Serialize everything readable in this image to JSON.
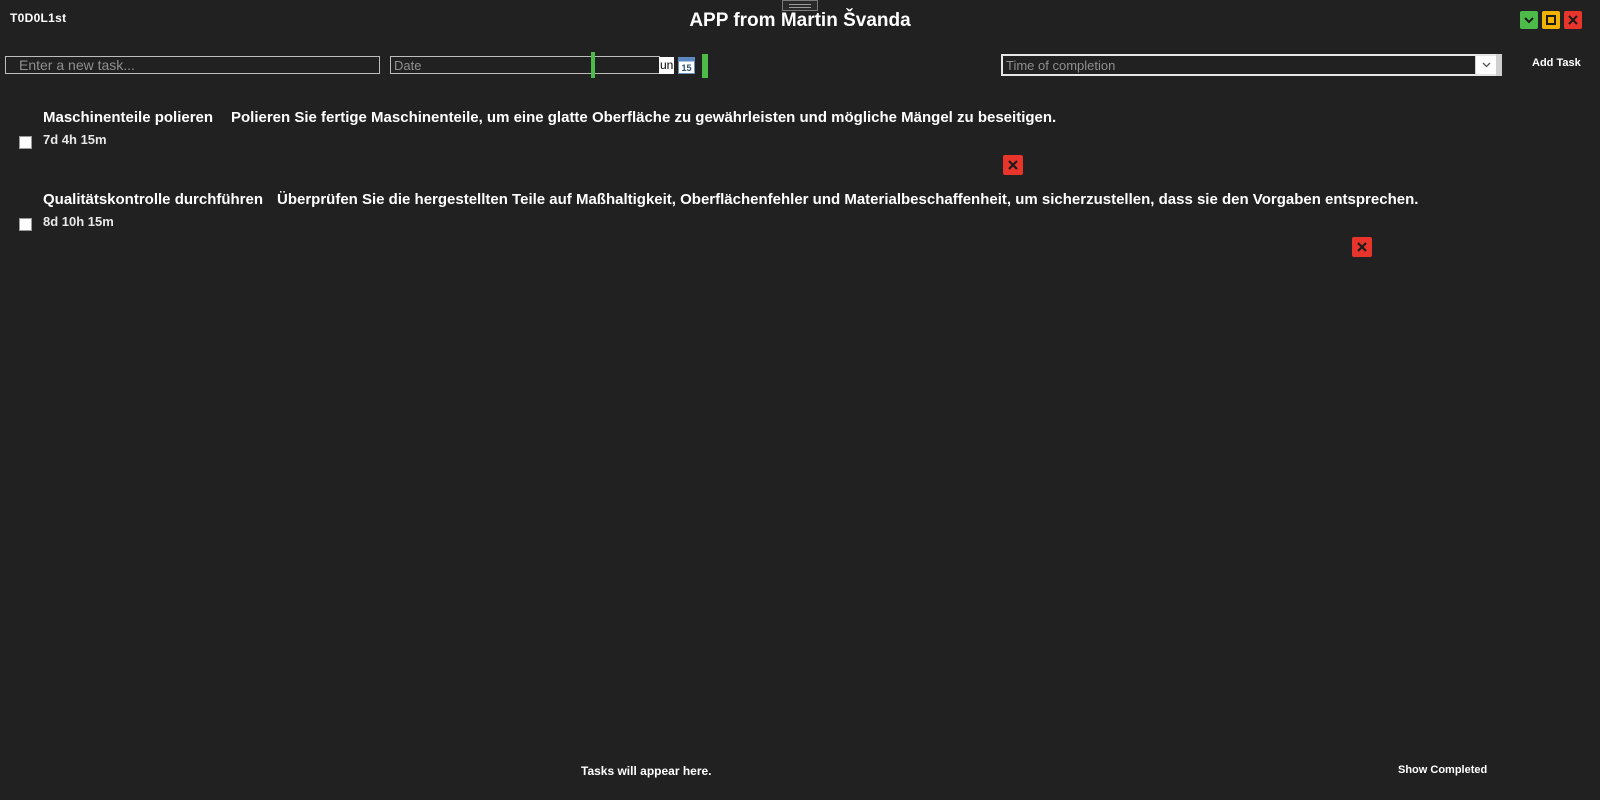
{
  "app": {
    "brand": "T0D0L1st",
    "title": "APP from Martin Švanda"
  },
  "window_controls": {
    "minimize_icon": "chevron-down-icon",
    "maximize_icon": "square-icon",
    "close_icon": "close-icon",
    "colors": {
      "minimize": "#4cbb4a",
      "maximize": "#f0b400",
      "close": "#e8352b"
    }
  },
  "form": {
    "task_placeholder": "Enter a new task...",
    "date_placeholder": "Date",
    "date_suffix": "un",
    "calendar_icon_label": "15",
    "time_placeholder": "Time of completion",
    "add_task_label": "Add Task"
  },
  "tasks": [
    {
      "name": "Maschinenteile polieren",
      "description": "Polieren Sie fertige Maschinenteile, um eine glatte Oberfläche zu gewährleisten und mögliche Mängel zu beseitigen.",
      "time": "7d 4h 15m",
      "completed": false
    },
    {
      "name": "Qualitätskontrolle durchführen",
      "description": "Überprüfen Sie die hergestellten Teile auf Maßhaltigkeit, Oberflächenfehler und Materialbeschaffenheit, um sicherzustellen, dass sie den Vorgaben entsprechen.",
      "time": "8d 10h 15m",
      "completed": false
    }
  ],
  "footer": {
    "hint": "Tasks will appear here.",
    "show_completed_label": "Show Completed"
  },
  "theme": {
    "background": "#212121",
    "text": "#ffffff",
    "accent_green": "#4cbb4a",
    "delete_red": "#e8352b"
  }
}
